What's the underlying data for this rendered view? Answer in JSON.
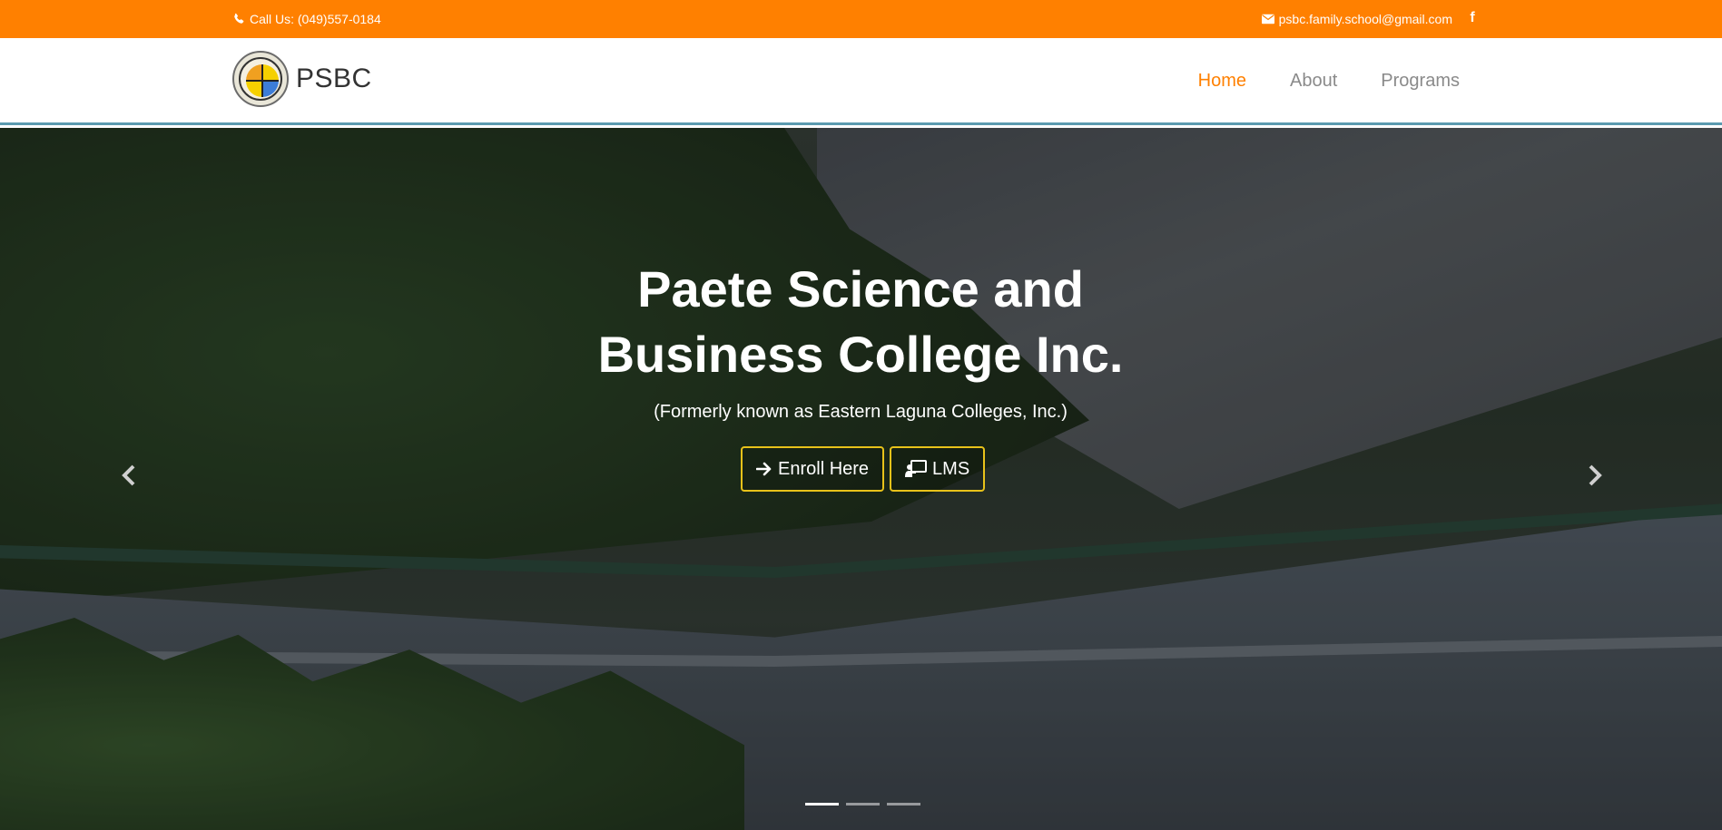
{
  "topbar": {
    "phone_icon": "phone-icon",
    "phone_text": "Call Us: (049)557-0184",
    "email_icon": "envelope-icon",
    "email_text": "psbc.family.school@gmail.com",
    "facebook_icon": "facebook-icon",
    "facebook_glyph": "f",
    "bg_color": "#ff8000"
  },
  "navbar": {
    "logo_icon": "school-seal-logo",
    "brand": "PSBC",
    "items": [
      {
        "label": "Home",
        "active": true
      },
      {
        "label": "About",
        "active": false
      },
      {
        "label": "Programs",
        "active": false
      }
    ],
    "active_color": "#ff8000"
  },
  "hero": {
    "title": "Paete Science and Business College Inc.",
    "subtitle": "(Formerly known as Eastern Laguna Colleges, Inc.)",
    "buttons": [
      {
        "label": "Enroll Here",
        "icon": "arrow-right-icon"
      },
      {
        "label": "LMS",
        "icon": "teacher-board-icon"
      }
    ],
    "prev_icon": "chevron-left-icon",
    "next_icon": "chevron-right-icon",
    "slides": 3,
    "active_slide": 1,
    "button_border_color": "#e8c21a"
  }
}
